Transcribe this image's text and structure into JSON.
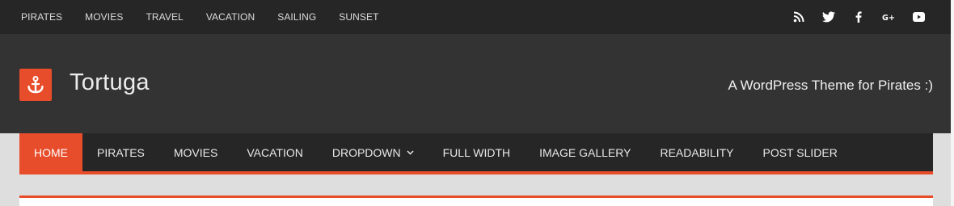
{
  "topbar": {
    "links": [
      "PIRATES",
      "MOVIES",
      "TRAVEL",
      "VACATION",
      "SAILING",
      "SUNSET"
    ],
    "social_icons": [
      "rss-icon",
      "twitter-icon",
      "facebook-icon",
      "google-plus-icon",
      "youtube-icon"
    ]
  },
  "header": {
    "logo_icon": "anchor-icon",
    "site_title": "Tortuga",
    "tagline": "A WordPress Theme for Pirates :)"
  },
  "main_nav": {
    "items": [
      {
        "label": "HOME",
        "active": true
      },
      {
        "label": "PIRATES"
      },
      {
        "label": "MOVIES"
      },
      {
        "label": "VACATION"
      },
      {
        "label": "DROPDOWN",
        "dropdown": true
      },
      {
        "label": "FULL WIDTH"
      },
      {
        "label": "IMAGE GALLERY"
      },
      {
        "label": "READABILITY"
      },
      {
        "label": "POST SLIDER"
      }
    ]
  },
  "colors": {
    "accent": "#e84d2b",
    "topbar_bg": "#262626",
    "header_bg": "#333333",
    "page_bg": "#dedede"
  }
}
